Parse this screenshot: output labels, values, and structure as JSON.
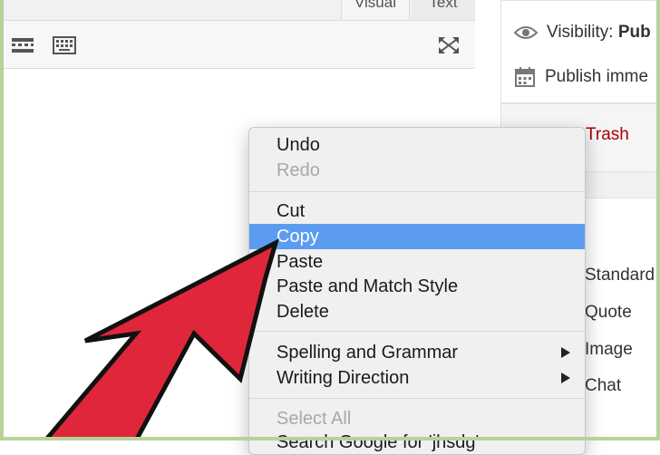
{
  "editor": {
    "tabs": [
      {
        "label": "Visual"
      },
      {
        "label": "Text"
      }
    ],
    "toolbar_icons": [
      "read-more-icon",
      "keyboard-icon",
      "fullscreen-icon"
    ]
  },
  "sidebar": {
    "visibility_label": "Visibility:",
    "visibility_value": "Pub",
    "publish_label": "Publish imme",
    "trash_label": "Trash",
    "formats": [
      "Standard",
      "Quote",
      "Image",
      "Chat"
    ]
  },
  "context_menu": {
    "items": [
      {
        "label": "Undo",
        "enabled": true
      },
      {
        "label": "Redo",
        "enabled": false
      },
      {
        "label": "Cut",
        "enabled": true
      },
      {
        "label": "Copy",
        "enabled": true,
        "highlighted": true
      },
      {
        "label": "Paste",
        "enabled": true
      },
      {
        "label": "Paste and Match Style",
        "enabled": true
      },
      {
        "label": "Delete",
        "enabled": true
      },
      {
        "label": "Spelling and Grammar",
        "enabled": true,
        "submenu": true
      },
      {
        "label": "Writing Direction",
        "enabled": true,
        "submenu": true
      },
      {
        "label": "Select All",
        "enabled": false
      },
      {
        "label": "Search Google for 'jhsdg'",
        "enabled": true
      }
    ]
  },
  "colors": {
    "highlight": "#5b9cf0",
    "arrow_fill": "#e0263a",
    "frame": "#b5d39a",
    "trash": "#aa0000"
  }
}
